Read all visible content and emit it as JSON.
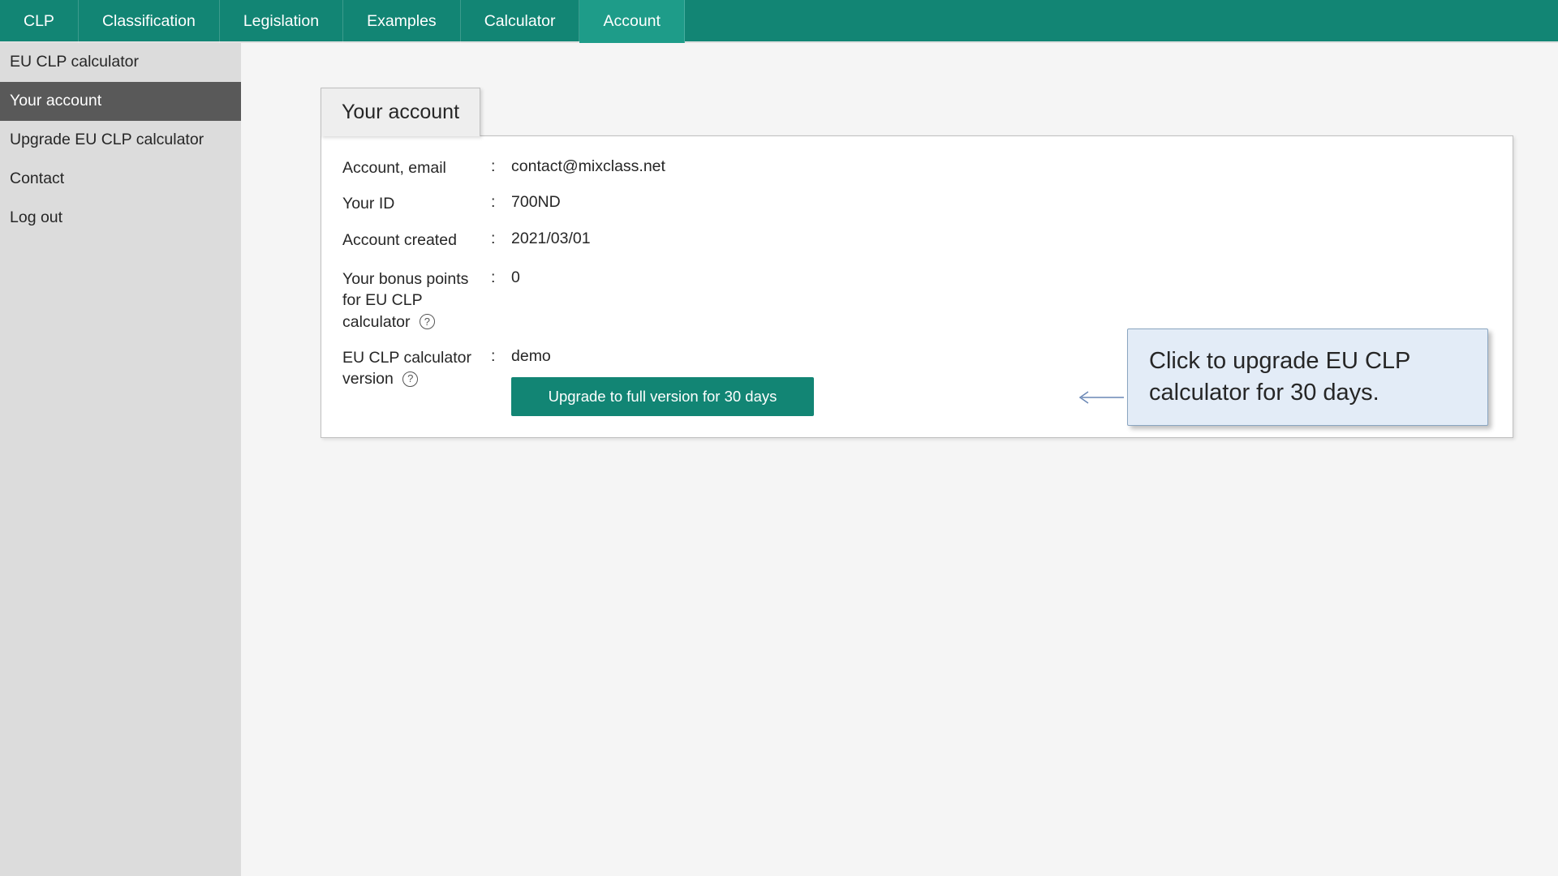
{
  "topnav": {
    "items": [
      {
        "label": "CLP"
      },
      {
        "label": "Classification"
      },
      {
        "label": "Legislation"
      },
      {
        "label": "Examples"
      },
      {
        "label": "Calculator"
      },
      {
        "label": "Account",
        "active": true
      }
    ]
  },
  "sidebar": {
    "items": [
      {
        "label": "EU CLP calculator"
      },
      {
        "label": "Your account",
        "active": true
      },
      {
        "label": "Upgrade EU CLP calculator"
      },
      {
        "label": "Contact"
      },
      {
        "label": "Log out"
      }
    ]
  },
  "page_title": "Your account",
  "account": {
    "email_label": "Account, email",
    "email_value": "contact@mixclass.net",
    "id_label": "Your ID",
    "id_value": "700ND",
    "created_label": "Account created",
    "created_value": "2021/03/01",
    "bonus_label": "Your bonus points for EU CLP calculator",
    "bonus_value": "0",
    "version_label": "EU CLP calculator version",
    "version_value": "demo",
    "upgrade_button": "Upgrade to full version for 30 days"
  },
  "callout": {
    "text": "Click to upgrade EU CLP calculator for 30 days."
  },
  "help_icon_glyph": "?",
  "colon": ":"
}
